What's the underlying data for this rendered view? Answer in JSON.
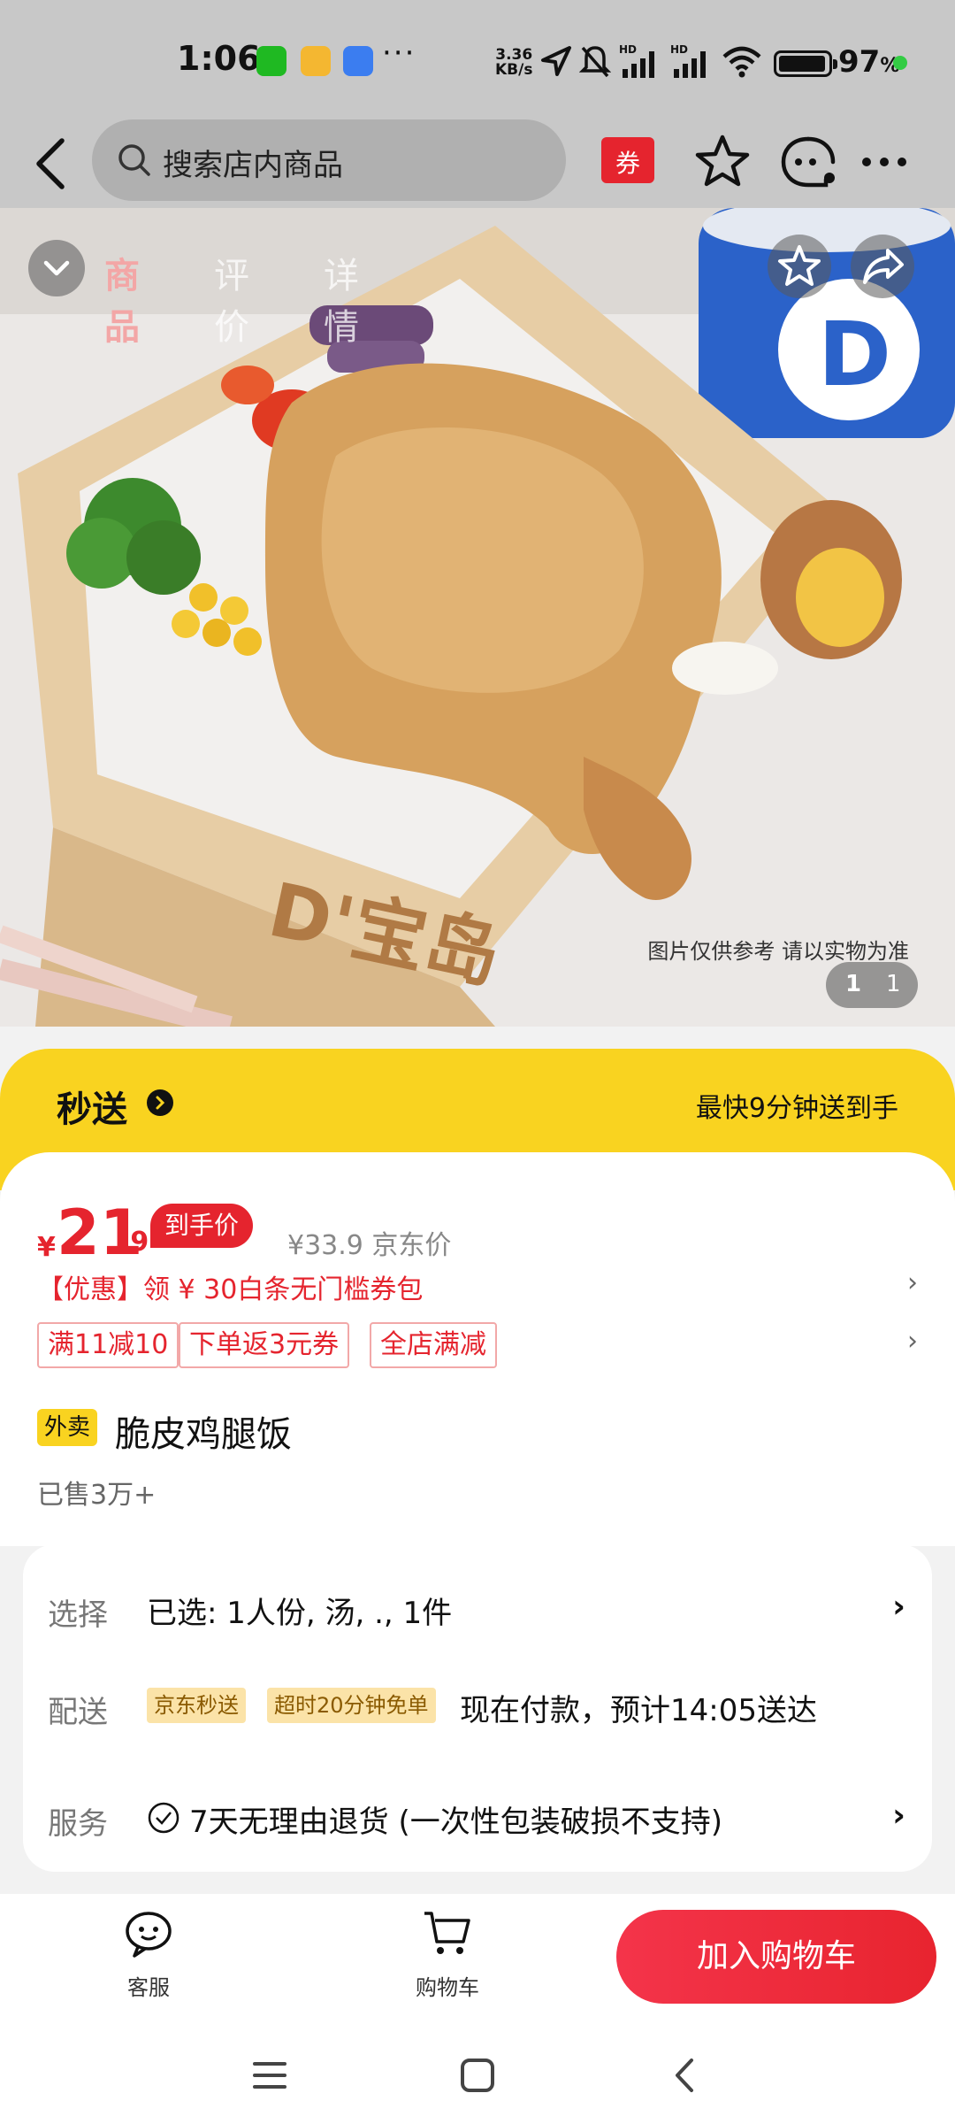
{
  "status_bar": {
    "time": "1:06",
    "net_speed_value": "3.36",
    "net_speed_unit": "KB/s",
    "battery_percent": "97",
    "battery_unit": "%",
    "battery_level": 0.97
  },
  "top_nav": {
    "search_placeholder": "搜索店内商品",
    "coupon_label": "券"
  },
  "hero": {
    "tabs": [
      "商品",
      "评价",
      "详情"
    ],
    "note": "图片仅供参考 请以实物为准",
    "counter_current": "1",
    "counter_total": "1"
  },
  "speed": {
    "title": "秒送",
    "right_text": "最快9分钟送到手"
  },
  "price": {
    "currency": "¥",
    "integer": "21",
    "decimal": ".9",
    "badge": "到手价",
    "original": "¥33.9 京东价",
    "promo": "【优惠】领 ¥ 30白条无门槛券包",
    "tags": [
      "满11减10",
      "下单返3元券",
      "全店满减"
    ]
  },
  "product": {
    "type_badge": "外卖",
    "name": "脆皮鸡腿饭",
    "sold": "已售3万+"
  },
  "options": {
    "select_label": "选择",
    "select_value": "已选: 1人份, 汤, ., 1件",
    "delivery_label": "配送",
    "delivery_badges": [
      "京东秒送",
      "超时20分钟免单"
    ],
    "delivery_value": "现在付款，预计14:05送达",
    "service_label": "服务",
    "service_value": "7天无理由退货 (一次性包装破损不支持)"
  },
  "bottom_bar": {
    "service_label": "客服",
    "cart_label": "购物车",
    "add_cart_label": "加入购物车"
  },
  "colors": {
    "accent_red": "#e5242e",
    "brand_yellow": "#f9d320"
  }
}
